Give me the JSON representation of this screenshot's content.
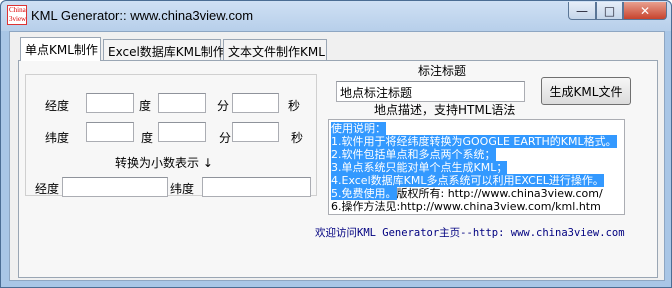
{
  "window": {
    "title": "KML Generator:: www.china3view.com",
    "icon_text_line1": "China",
    "icon_text_line2": "3view",
    "min_glyph": "—",
    "max_glyph": "□",
    "close_glyph": "✕"
  },
  "tabs": [
    {
      "label": "单点KML制作",
      "active": true
    },
    {
      "label": "Excel数据库KML制作",
      "active": false
    },
    {
      "label": "文本文件制作KML",
      "active": false
    }
  ],
  "coords": {
    "longitude_label": "经度",
    "latitude_label": "纬度",
    "degree_label": "度",
    "minute_label": "分",
    "second_label": "秒",
    "lon_deg": "",
    "lon_min": "",
    "lon_sec": "",
    "lat_deg": "",
    "lat_min": "",
    "lat_sec": "",
    "convert_label": "转换为小数表示 ↓",
    "decimal_lon_label": "经度",
    "decimal_lat_label": "纬度",
    "decimal_lon": "",
    "decimal_lat": ""
  },
  "annotation": {
    "title_label": "标注标题",
    "title_value": "地点标注标题",
    "generate_button": "生成KML文件",
    "description_label": "地点描述，支持HTML语法",
    "description_lines": [
      {
        "text": "使用说明：",
        "selected": true
      },
      {
        "text": "1.软件用于将经纬度转换为GOOGLE EARTH的KML格式。",
        "selected": true
      },
      {
        "text": "2.软件包括单点和多点两个系统；",
        "selected": true
      },
      {
        "text": "3.单点系统只能对单个点生成KML；",
        "selected": true
      },
      {
        "text": "4.Excel数据库KML多点系统可以利用EXCEL进行操作。",
        "selected": true
      },
      {
        "text": "5.免费使用。",
        "selected": true,
        "rest": "版权所有: http://www.china3view.com/"
      },
      {
        "text": "6.操作方法见:http://www.china3view.com/kml.htm",
        "selected": false
      }
    ]
  },
  "footer": {
    "link_text": "欢迎访问KML Generator主页--http: www.china3view.com"
  }
}
